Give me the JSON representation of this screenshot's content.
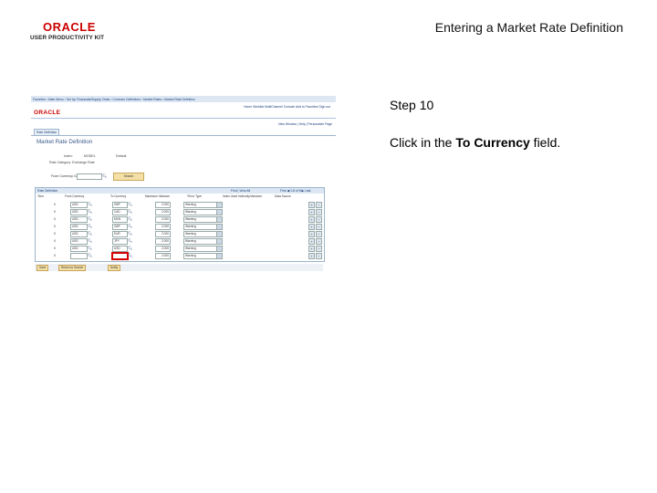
{
  "header": {
    "logo_text": "ORACLE",
    "logo_tagline": "USER PRODUCTIVITY KIT",
    "page_title": "Entering a Market Rate Definition"
  },
  "instructions": {
    "step": "Step 10",
    "prefix": "Click in the ",
    "field_name": "To Currency",
    "suffix": " field."
  },
  "screenshot": {
    "breadcrumbs": "Favorites  ›  Main Menu  ›  Set Up Financials/Supply Chain  ›  Common Definitions  ›  Market Rates  ›  Market Rate Definition",
    "top_links": "Home    Worklist    MultiChannel Console    Add to Favorites    Sign out",
    "logo_text": "ORACLE",
    "page_links": "New Window  |  Help  |  Personalize Page",
    "tab_label": "Rate Definition",
    "heading": "Market Rate Definition",
    "index_label": "Index:",
    "index_value": "MODEL",
    "default_label": "Default",
    "rate_category_label": "Rate Category:  Exchange Rate",
    "from_currency_label": "From Currency Code:",
    "search_button": "Search",
    "grid_title": "Rate Definition",
    "grid_nav_1": "Find  |  View All",
    "grid_nav_2": "First  ◀  1-8 of 8  ▶  Last",
    "columns": [
      "Term",
      "From Currency",
      "To Currency",
      "Maximum Variance",
      "*Error Type",
      "Index Used Indirectly/Variance",
      "Data Source"
    ],
    "rows": [
      {
        "term": "0",
        "from": "USD",
        "to": "GBP",
        "variance": "2.000",
        "error": "Warning"
      },
      {
        "term": "0",
        "from": "USD",
        "to": "CAD",
        "variance": "2.000",
        "error": "Warning"
      },
      {
        "term": "0",
        "from": "USD",
        "to": "MXN",
        "variance": "2.000",
        "error": "Warning"
      },
      {
        "term": "0",
        "from": "USD",
        "to": "GBP",
        "variance": "2.000",
        "error": "Warning"
      },
      {
        "term": "0",
        "from": "USD",
        "to": "EUR",
        "variance": "2.000",
        "error": "Warning"
      },
      {
        "term": "0",
        "from": "USD",
        "to": "JPY",
        "variance": "2.000",
        "error": "Warning"
      },
      {
        "term": "0",
        "from": "USD",
        "to": "USD",
        "variance": "2.000",
        "error": "Warning"
      },
      {
        "term": "0",
        "from": "",
        "to": "",
        "variance": "2.000",
        "error": "Warning"
      }
    ],
    "buttons": [
      "Save",
      "Return to Search",
      "Notify"
    ]
  },
  "colors": {
    "brand_red": "#cc0000",
    "highlight": "#d40000",
    "peoplesoft_blue": "#dce7f3"
  }
}
